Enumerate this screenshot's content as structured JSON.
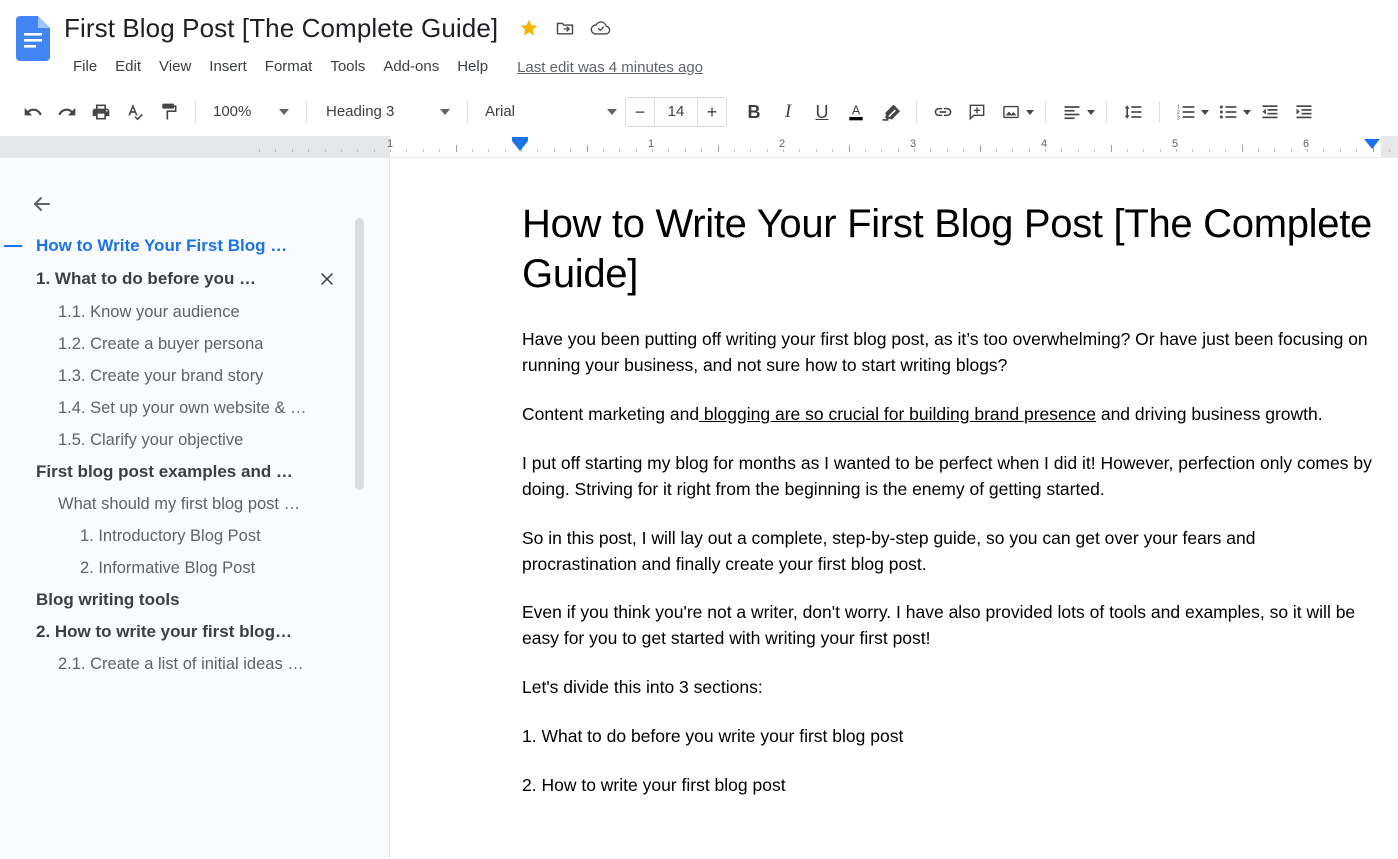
{
  "app": {
    "logo_icon": "google-docs-icon"
  },
  "header": {
    "title": "First Blog Post [The Complete Guide]",
    "icons": [
      {
        "name": "star-icon",
        "glyph": "star"
      },
      {
        "name": "move-to-folder-icon",
        "glyph": "folder-add"
      },
      {
        "name": "cloud-saved-icon",
        "glyph": "cloud-check"
      }
    ],
    "menu": [
      "File",
      "Edit",
      "View",
      "Insert",
      "Format",
      "Tools",
      "Add-ons",
      "Help"
    ],
    "last_edit": "Last edit was 4 minutes ago"
  },
  "toolbar": {
    "undo": "undo-icon",
    "redo": "redo-icon",
    "print": "print-icon",
    "spelling": "spellcheck-icon",
    "paint_format": "paint-format-icon",
    "zoom_value": "100%",
    "style_value": "Heading 3",
    "font_value": "Arial",
    "font_size": "14",
    "font_size_decrease": "−",
    "font_size_increase": "+",
    "bold": "B",
    "italic": "I",
    "underline": "U",
    "text_color": "A",
    "highlight": "highlight-icon",
    "insert_link": "link-icon",
    "add_comment": "comment-icon",
    "insert_image": "image-icon",
    "align": "align-left-icon",
    "line_spacing": "line-spacing-icon",
    "numbered_list": "numbered-list-icon",
    "bulleted_list": "bulleted-list-icon",
    "decrease_indent": "decrease-indent-icon",
    "increase_indent": "increase-indent-icon"
  },
  "ruler": {
    "numbers": [
      "1",
      "1",
      "2",
      "3",
      "4",
      "5",
      "6"
    ],
    "left_indent_position": "0.5",
    "right_indent_position": "6.5"
  },
  "outline": {
    "back_icon": "back-arrow-icon",
    "close_icon": "close-icon",
    "collapse_icon": "collapse-minus-icon",
    "items": [
      {
        "label": "How to Write Your First Blog …",
        "level": 0,
        "active": true,
        "has_close": false
      },
      {
        "label": "1. What to do before you …",
        "level": 1,
        "active": false,
        "has_close": true
      },
      {
        "label": "1.1. Know your audience",
        "level": 2,
        "active": false,
        "has_close": false
      },
      {
        "label": "1.2. Create a buyer persona",
        "level": 2,
        "active": false,
        "has_close": false
      },
      {
        "label": "1.3. Create your brand story",
        "level": 2,
        "active": false,
        "has_close": false
      },
      {
        "label": "1.4. Set up your own website & …",
        "level": 2,
        "active": false,
        "has_close": false
      },
      {
        "label": "1.5. Clarify your objective",
        "level": 2,
        "active": false,
        "has_close": false
      },
      {
        "label": "First blog post examples and …",
        "level": 1,
        "active": false,
        "has_close": false
      },
      {
        "label": "What should my first blog post …",
        "level": 2,
        "active": false,
        "has_close": false
      },
      {
        "label": "1. Introductory Blog Post",
        "level": 3,
        "active": false,
        "has_close": false
      },
      {
        "label": "2. Informative Blog Post",
        "level": 3,
        "active": false,
        "has_close": false
      },
      {
        "label": "Blog writing tools",
        "level": 1,
        "active": false,
        "has_close": false
      },
      {
        "label": "2. How to write your first blog…",
        "level": 1,
        "active": false,
        "has_close": false
      },
      {
        "label": "2.1. Create a list of initial ideas …",
        "level": 2,
        "active": false,
        "has_close": false
      }
    ]
  },
  "document": {
    "heading": "How to Write Your First Blog Post [The Complete Guide]",
    "paragraphs": [
      {
        "type": "plain",
        "text": "Have you been putting off writing your first blog post, as it’s too overwhelming? Or have just been focusing on running your business, and not sure how to start writing blogs?"
      },
      {
        "type": "link",
        "before": "Content marketing and",
        "link": " blogging are so crucial for building brand presence",
        "after": " and driving business growth."
      },
      {
        "type": "plain",
        "text": "I put off starting my blog for months as I wanted to be perfect when I did it! However, perfection only comes by doing. Striving for it right from the beginning is the enemy of getting started."
      },
      {
        "type": "plain",
        "text": "So in this post, I will lay out a complete, step-by-step guide, so you can get over your fears and procrastination and finally create your first blog post."
      },
      {
        "type": "plain",
        "text": "Even if you think you're not a writer, don't worry. I have also provided lots of tools and examples, so it will be easy for you to get started with writing your first post!"
      },
      {
        "type": "plain",
        "text": "Let's divide this into 3 sections:"
      },
      {
        "type": "plain",
        "text": "1. What to do before you write your first blog post"
      },
      {
        "type": "plain",
        "text": "2. How to write your first blog post"
      }
    ]
  },
  "colors": {
    "accent_blue": "#1a73e8",
    "star_yellow": "#f4b400",
    "sidebar_bg": "#f9fbfd",
    "text_primary": "#202124",
    "text_secondary": "#5f6368"
  }
}
